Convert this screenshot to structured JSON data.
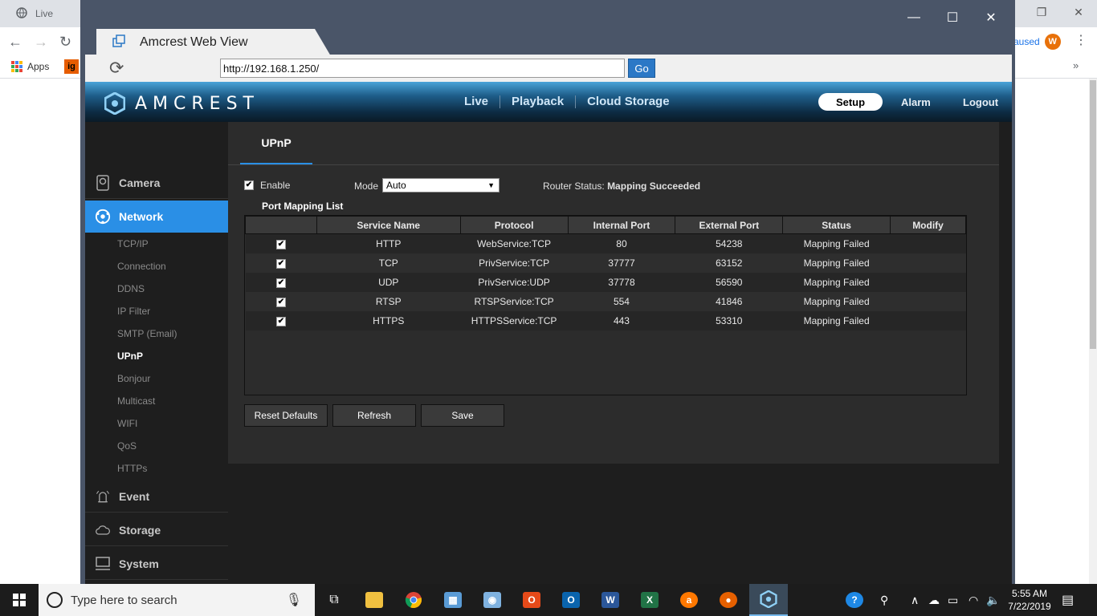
{
  "chrome": {
    "tab_title": "Live",
    "bookmark_apps": "Apps",
    "bookmark_ig": "ig",
    "paused_label": "aused",
    "avatar_letter": "W",
    "more": "»"
  },
  "app_window": {
    "tab_title": "Amcrest Web View",
    "url": "http://192.168.1.250/",
    "go_label": "Go"
  },
  "header": {
    "logo_text": "AMCREST",
    "nav": [
      "Live",
      "Playback",
      "Cloud Storage"
    ],
    "setup": "Setup",
    "alarm": "Alarm",
    "logout": "Logout",
    "colors": {
      "accent": "#2a8fe6",
      "header_top": "#4aa3d8",
      "header_bottom": "#0a1a26"
    }
  },
  "sidebar": {
    "sections": [
      {
        "label": "Camera",
        "icon": "camera-icon"
      },
      {
        "label": "Network",
        "icon": "network-icon"
      },
      {
        "label": "Event",
        "icon": "alarm-bell-icon"
      },
      {
        "label": "Storage",
        "icon": "cloud-icon"
      },
      {
        "label": "System",
        "icon": "monitor-icon"
      }
    ],
    "network_items": [
      "TCP/IP",
      "Connection",
      "DDNS",
      "IP Filter",
      "SMTP (Email)",
      "UPnP",
      "Bonjour",
      "Multicast",
      "WIFI",
      "QoS",
      "HTTPs"
    ],
    "active_item": "UPnP"
  },
  "content": {
    "tab": "UPnP",
    "enable_label": "Enable",
    "mode_label": "Mode",
    "mode_value": "Auto",
    "router_status_label": "Router Status:",
    "router_status_value": "Mapping Succeeded",
    "list_label": "Port Mapping List",
    "columns": [
      "",
      "Service Name",
      "Protocol",
      "Internal Port",
      "External Port",
      "Status",
      "Modify"
    ],
    "rows": [
      {
        "service": "HTTP",
        "protocol": "WebService:TCP",
        "internal": "80",
        "external": "54238",
        "status": "Mapping Failed"
      },
      {
        "service": "TCP",
        "protocol": "PrivService:TCP",
        "internal": "37777",
        "external": "63152",
        "status": "Mapping Failed"
      },
      {
        "service": "UDP",
        "protocol": "PrivService:UDP",
        "internal": "37778",
        "external": "56590",
        "status": "Mapping Failed"
      },
      {
        "service": "RTSP",
        "protocol": "RTSPService:TCP",
        "internal": "554",
        "external": "41846",
        "status": "Mapping Failed"
      },
      {
        "service": "HTTPS",
        "protocol": "HTTPSService:TCP",
        "internal": "443",
        "external": "53310",
        "status": "Mapping Failed"
      }
    ],
    "buttons": {
      "reset": "Reset Defaults",
      "refresh": "Refresh",
      "save": "Save"
    }
  },
  "taskbar": {
    "search_placeholder": "Type here to search",
    "time": "5:55 AM",
    "date": "7/22/2019"
  }
}
